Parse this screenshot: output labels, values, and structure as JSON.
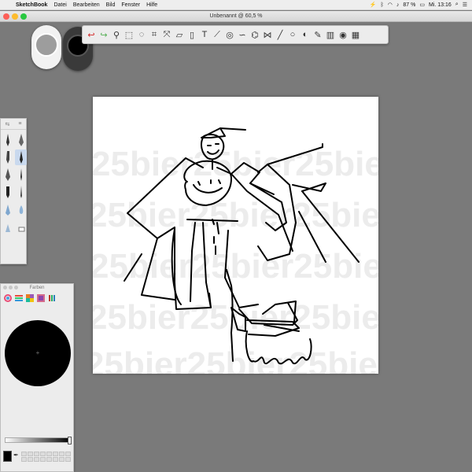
{
  "menubar": {
    "apple": "",
    "app_name": "SketchBook",
    "menus": [
      "Datei",
      "Bearbeiten",
      "Bild",
      "Fenster",
      "Hilfe"
    ],
    "battery": "87 %",
    "clock": "Mi. 13:16"
  },
  "window": {
    "title": "Unbenannt @ 60,5 %"
  },
  "color_panel": {
    "title": "Farben"
  },
  "canvas": {
    "watermark": "25bier25bier25bier25bier"
  },
  "colors": {
    "close": "#fc5f57",
    "minimize": "#fdbc2e",
    "zoom": "#28c840"
  }
}
